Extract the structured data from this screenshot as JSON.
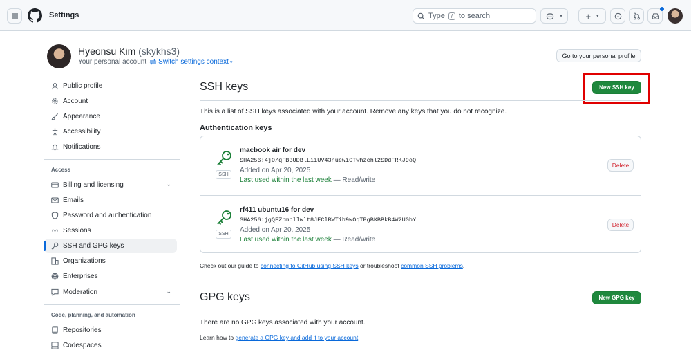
{
  "header": {
    "title": "Settings",
    "search_type": "Type",
    "search_key": "/",
    "search_suffix": "to search"
  },
  "profile": {
    "name": "Hyeonsu Kim",
    "handle": "(skykhs3)",
    "subtitle": "Your personal account",
    "switch_label": "Switch settings context",
    "go_profile": "Go to your personal profile"
  },
  "sidebar": {
    "items_top": [
      {
        "label": "Public profile",
        "icon": "person-icon"
      },
      {
        "label": "Account",
        "icon": "gear-icon"
      },
      {
        "label": "Appearance",
        "icon": "paintbrush-icon"
      },
      {
        "label": "Accessibility",
        "icon": "accessibility-icon"
      },
      {
        "label": "Notifications",
        "icon": "bell-icon"
      }
    ],
    "access_heading": "Access",
    "items_access": [
      {
        "label": "Billing and licensing",
        "icon": "credit-card-icon"
      },
      {
        "label": "Emails",
        "icon": "mail-icon"
      },
      {
        "label": "Password and authentication",
        "icon": "shield-lock-icon"
      },
      {
        "label": "Sessions",
        "icon": "broadcast-icon"
      },
      {
        "label": "SSH and GPG keys",
        "icon": "key-icon"
      },
      {
        "label": "Organizations",
        "icon": "organization-icon"
      },
      {
        "label": "Enterprises",
        "icon": "globe-icon"
      },
      {
        "label": "Moderation",
        "icon": "report-icon"
      }
    ],
    "code_heading": "Code, planning, and automation",
    "items_code": [
      {
        "label": "Repositories",
        "icon": "repo-icon"
      },
      {
        "label": "Codespaces",
        "icon": "codespaces-icon"
      }
    ]
  },
  "ssh": {
    "title": "SSH keys",
    "new_button": "New SSH key",
    "description": "This is a list of SSH keys associated with your account. Remove any keys that you do not recognize.",
    "auth_heading": "Authentication keys",
    "keys": [
      {
        "name": "macbook air for dev",
        "fingerprint": "SHA256:4jO/qFBBUDBlLiiUV43nuewiGTwhzchl2SDdFRKJ9oQ",
        "added": "Added on Apr 20, 2025",
        "last_used": "Last used within the last week",
        "access": " — Read/write",
        "badge": "SSH",
        "delete_label": "Delete"
      },
      {
        "name": "rf411 ubuntu16 for dev",
        "fingerprint": "SHA256:jgQFZbmpllwlt8JEClBWTib9wOqTPgBKBBkB4W2UGbY",
        "added": "Added on Apr 20, 2025",
        "last_used": "Last used within the last week",
        "access": " — Read/write",
        "badge": "SSH",
        "delete_label": "Delete"
      }
    ],
    "guide_prefix": "Check out our guide to ",
    "guide_link1": "connecting to GitHub using SSH keys",
    "guide_middle": " or troubleshoot ",
    "guide_link2": "common SSH problems",
    "guide_suffix": "."
  },
  "gpg": {
    "title": "GPG keys",
    "new_button": "New GPG key",
    "none_text": "There are no GPG keys associated with your account.",
    "learn_prefix": "Learn how to ",
    "learn_link": "generate a GPG key and add it to your account",
    "learn_suffix": "."
  },
  "colors": {
    "accent": "#0969da",
    "green": "#1f883d",
    "danger": "#d1242f",
    "highlight": "#e00000"
  }
}
